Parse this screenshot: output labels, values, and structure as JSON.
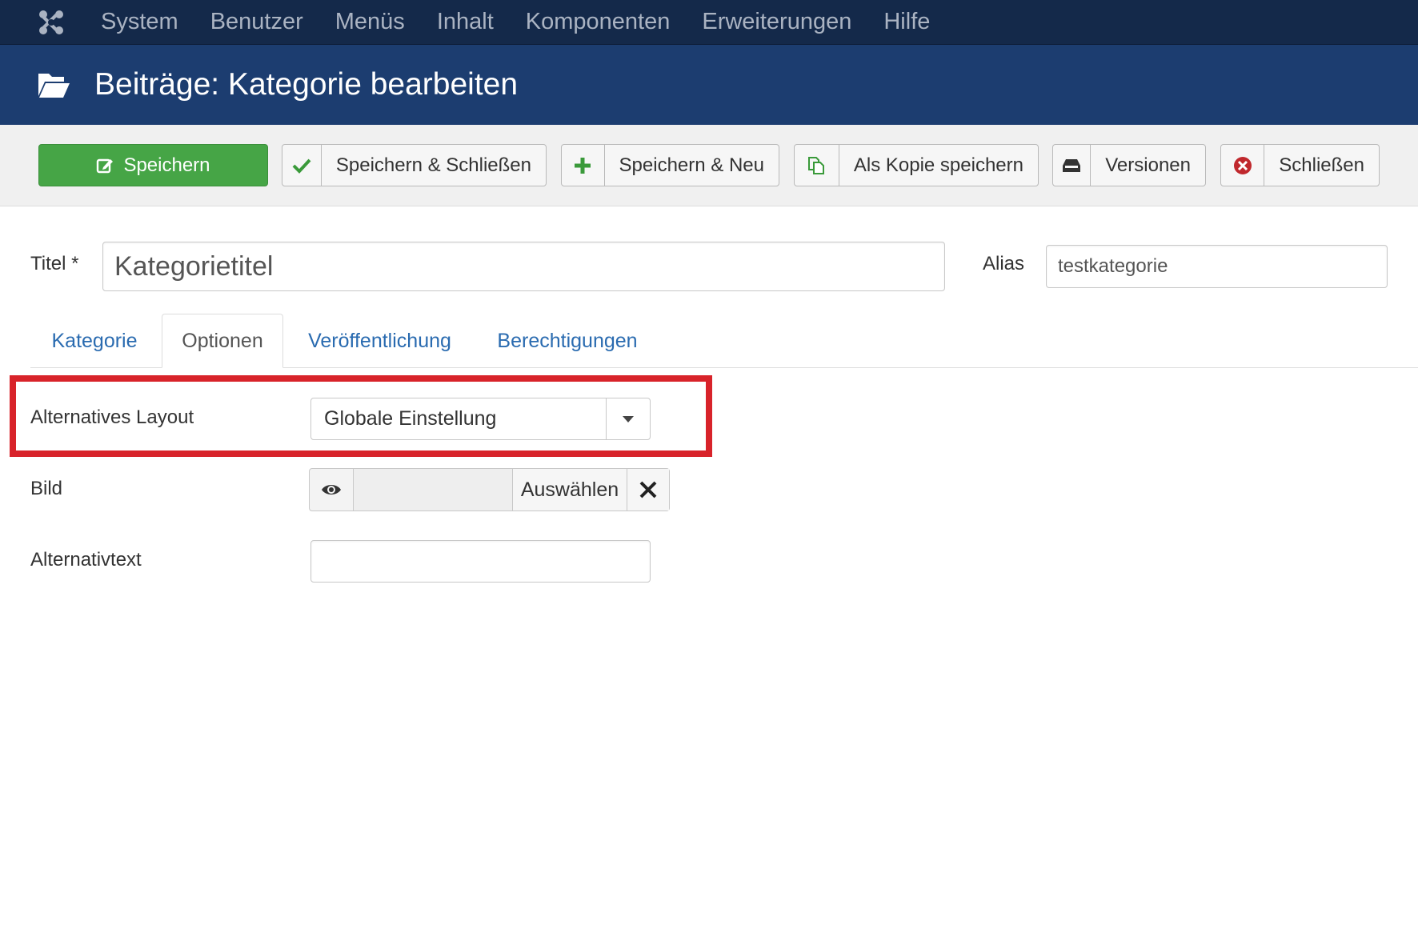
{
  "navbar": {
    "items": [
      "System",
      "Benutzer",
      "Menüs",
      "Inhalt",
      "Komponenten",
      "Erweiterungen",
      "Hilfe"
    ]
  },
  "header": {
    "title": "Beiträge: Kategorie bearbeiten",
    "icon": "folder-open-icon"
  },
  "toolbar": {
    "save": "Speichern",
    "save_close": "Speichern & Schließen",
    "save_new": "Speichern & Neu",
    "save_copy": "Als Kopie speichern",
    "versions": "Versionen",
    "close": "Schließen"
  },
  "form": {
    "title_label": "Titel *",
    "title_value": "Kategorietitel",
    "alias_label": "Alias",
    "alias_value": "testkategorie"
  },
  "tabs": [
    "Kategorie",
    "Optionen",
    "Veröffentlichung",
    "Berechtigungen"
  ],
  "active_tab": "Optionen",
  "options": {
    "layout_label": "Alternatives Layout",
    "layout_value": "Globale Einstellung",
    "image_label": "Bild",
    "image_choose": "Auswählen",
    "alt_label": "Alternativtext",
    "alt_value": ""
  },
  "colors": {
    "navbar": "#14294a",
    "header": "#1c3d70",
    "save_button": "#46a546",
    "link": "#2a6bb0",
    "highlight": "#d8232a"
  }
}
